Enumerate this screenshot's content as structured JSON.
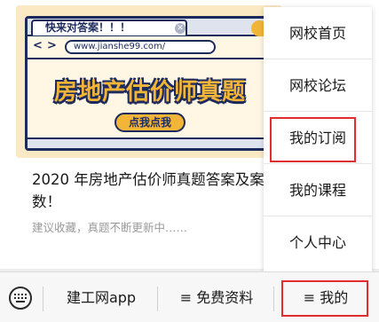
{
  "article": {
    "banner": {
      "tab_text": "快来对答案！！！",
      "tab_close": "✕",
      "back_arrow": "<",
      "forward_arrow": ">",
      "url": "www.jianshe99.com/",
      "headline": "房地产估价师真题",
      "cta": "点我点我"
    },
    "title": "2020 年房地产估价师真题答案及案，提早知道分数！",
    "subtitle": "建议收藏，真题不断更新中……"
  },
  "menu": {
    "items": [
      {
        "label": "网校首页"
      },
      {
        "label": "网校论坛"
      },
      {
        "label": "我的订阅"
      },
      {
        "label": "我的课程"
      },
      {
        "label": "个人中心"
      }
    ],
    "highlight_color": "#e02e2e"
  },
  "bottom_nav": {
    "keyboard_icon": "keyboard-icon",
    "items": [
      {
        "label": "建工网app"
      },
      {
        "label": "≡ 免费资料"
      },
      {
        "label": "≡ 我的"
      }
    ]
  }
}
